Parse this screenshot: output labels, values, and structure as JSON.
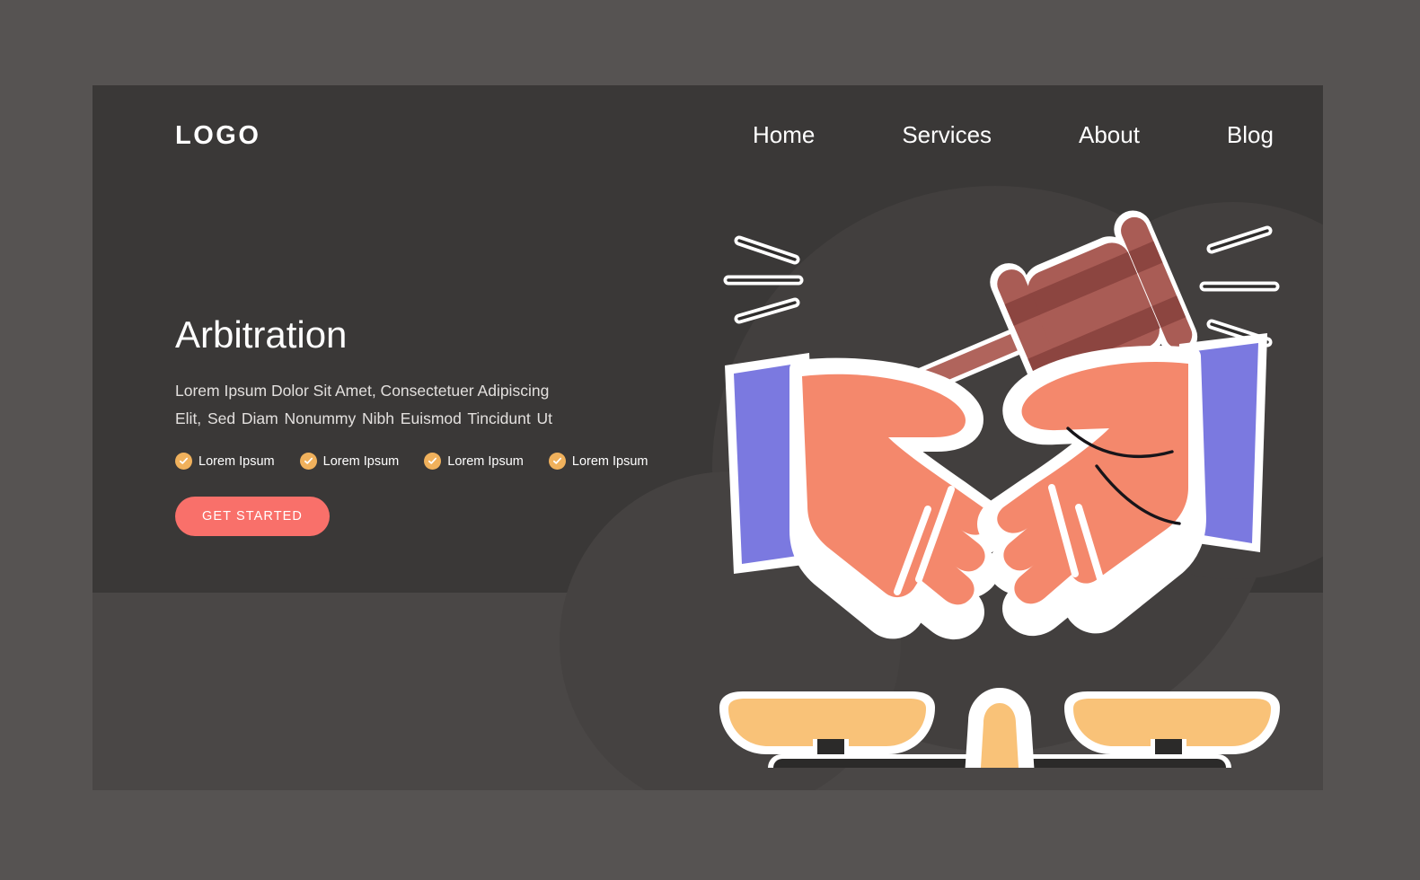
{
  "page": {
    "background_color": "#565352",
    "card_background": "#4a4746",
    "hero_panel_color": "#3a3837"
  },
  "header": {
    "logo": "LOGO",
    "nav": [
      {
        "label": "Home",
        "name": "nav-item-home"
      },
      {
        "label": "Services",
        "name": "nav-item-services"
      },
      {
        "label": "About",
        "name": "nav-item-about"
      },
      {
        "label": "Blog",
        "name": "nav-item-blog"
      }
    ]
  },
  "hero": {
    "title": "Arbitration",
    "subtitle_line_1": "Lorem Ipsum Dolor Sit Amet, Consectetuer Adipiscing",
    "subtitle_line_2": "Elit, Sed Diam Nonummy Nibh Euismod Tincidunt Ut",
    "features": [
      {
        "label": "Lorem Ipsum",
        "icon": "check-circle-icon"
      },
      {
        "label": "Lorem Ipsum",
        "icon": "check-circle-icon"
      },
      {
        "label": "Lorem Ipsum",
        "icon": "check-circle-icon"
      },
      {
        "label": "Lorem Ipsum",
        "icon": "check-circle-icon"
      }
    ],
    "cta_label": "GET STARTED",
    "cta_color": "#f9706a",
    "check_color": "#f0b15c"
  },
  "illustration": {
    "name": "arbitration-illustration",
    "elements": [
      "gavel-icon",
      "motion-lines-left",
      "motion-lines-right",
      "handshake-icon",
      "justice-scales-icon"
    ],
    "colors": {
      "gavel_body": "#a95c55",
      "gavel_band": "#8c4540",
      "gavel_handle": "#b0645c",
      "skin": "#f4886c",
      "sleeve": "#7b79e0",
      "scale_gold": "#f9c278",
      "scale_beam": "#2b2a29",
      "outline": "#ffffff"
    }
  }
}
